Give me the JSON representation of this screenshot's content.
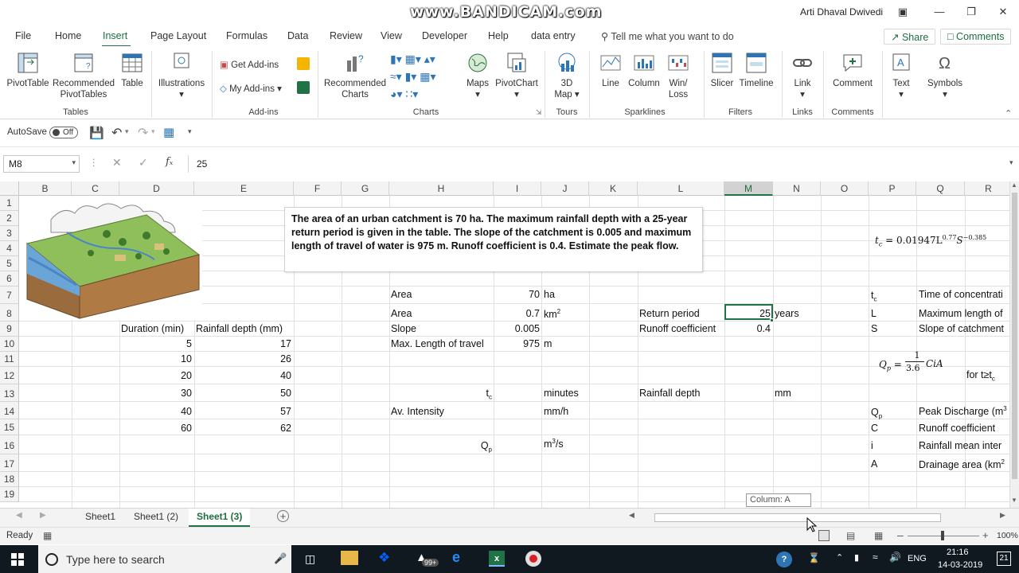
{
  "watermark": "www.BANDICAM.com",
  "user": "Arti Dhaval Dwivedi",
  "ribbon_tabs": [
    "File",
    "Home",
    "Insert",
    "Page Layout",
    "Formulas",
    "Data",
    "Review",
    "View",
    "Developer",
    "Help",
    "data entry"
  ],
  "tell_me": "Tell me what you want to do",
  "share": "Share",
  "comments": "Comments",
  "ribbon": {
    "tables": {
      "pivottable": "PivotTable",
      "recommended_pivot_1": "Recommended",
      "recommended_pivot_2": "PivotTables",
      "table": "Table",
      "group": "Tables"
    },
    "illustrations": "Illustrations",
    "addins": {
      "get": "Get Add-ins",
      "my": "My Add-ins",
      "group": "Add-ins"
    },
    "charts": {
      "rec1": "Recommended",
      "rec2": "Charts",
      "maps": "Maps",
      "pivotchart": "PivotChart",
      "group": "Charts"
    },
    "tours": {
      "map1": "3D",
      "map2": "Map",
      "group": "Tours"
    },
    "sparklines": {
      "line": "Line",
      "column": "Column",
      "winloss1": "Win/",
      "winloss2": "Loss",
      "group": "Sparklines"
    },
    "filters": {
      "slicer": "Slicer",
      "timeline": "Timeline",
      "group": "Filters"
    },
    "links": {
      "link": "Link",
      "group": "Links"
    },
    "comments": {
      "comment": "Comment",
      "group": "Comments"
    },
    "text": "Text",
    "symbols": "Symbols"
  },
  "autosave": {
    "label": "AutoSave",
    "state": "Off"
  },
  "namebox": "M8",
  "formula": "25",
  "columns": [
    "B",
    "C",
    "D",
    "E",
    "F",
    "G",
    "H",
    "I",
    "J",
    "K",
    "L",
    "M",
    "N",
    "O",
    "P",
    "Q",
    "R"
  ],
  "rows": [
    "1",
    "2",
    "3",
    "4",
    "5",
    "6",
    "7",
    "8",
    "9",
    "10",
    "11",
    "12",
    "13",
    "14",
    "15",
    "16",
    "17",
    "18",
    "19"
  ],
  "problem": "The area of an urban catchment is 70 ha. The maximum rainfall depth with a 25-year return period is given in the table. The slope of the catchment is 0.005 and maximum length of travel of water is 975 m. Runoff coefficient is 0.4.  Estimate the peak flow.",
  "table": {
    "h_duration": "Duration (min)",
    "h_rainfall": "Rainfall depth (mm)",
    "rows": [
      {
        "d": "5",
        "r": "17"
      },
      {
        "d": "10",
        "r": "26"
      },
      {
        "d": "20",
        "r": "40"
      },
      {
        "d": "30",
        "r": "50"
      },
      {
        "d": "40",
        "r": "57"
      },
      {
        "d": "60",
        "r": "62"
      }
    ]
  },
  "calc": {
    "area_label": "Area",
    "area_ha": "70",
    "unit_ha": "ha",
    "area2_label": "Area",
    "area_km2": "0.7",
    "unit_km": "km",
    "sup2": "2",
    "slope_label": "Slope",
    "slope": "0.005",
    "maxlen_label": "Max. Length of travel",
    "maxlen": "975",
    "unit_m": "m",
    "tc": "t",
    "tc_sub": "c",
    "minutes": "minutes",
    "avint": "Av. Intensity",
    "mmh": "mm/h",
    "qp": "Q",
    "qp_sub": "p",
    "m3s_a": "m",
    "m3s_sup": "3",
    "m3s_b": "/s",
    "return_label": "Return period",
    "return_val": "25",
    "years": "years",
    "runoff_label": "Runoff coefficient",
    "runoff_val": "0.4",
    "rainfall_depth": "Rainfall depth",
    "mm": "mm"
  },
  "legend": {
    "tc_formula_a": "t",
    "tc_formula_sub": "c",
    "tc_formula_b": " = 0.01947L",
    "tc_exp1": "0.77",
    "tc_formula_c": "S",
    "tc_exp2": "−0.385",
    "items": [
      {
        "sym": "t",
        "sub": "c",
        "desc": "Time of concentrati"
      },
      {
        "sym": "L",
        "sub": "",
        "desc": "Maximum length of"
      },
      {
        "sym": "S",
        "sub": "",
        "desc": "Slope of catchment"
      }
    ],
    "qp_a": "Q",
    "qp_sub": "p",
    "qp_eq": " = ",
    "qp_num": "1",
    "qp_den": "3.6",
    "qp_tail": "CiA",
    "for_t": "for t≥t",
    "for_sub": "c",
    "items2": [
      {
        "sym": "Q",
        "sub": "p",
        "desc": "Peak Discharge (m",
        "sup": "3"
      },
      {
        "sym": "C",
        "sub": "",
        "desc": "Runoff coefficient",
        "sup": ""
      },
      {
        "sym": "i",
        "sub": "",
        "desc": "Rainfall mean inter",
        "sup": ""
      },
      {
        "sym": "A",
        "sub": "",
        "desc": "Drainage area (km",
        "sup": "2"
      }
    ]
  },
  "tooltip": "Column: A",
  "sheets": [
    "Sheet1",
    "Sheet1 (2)",
    "Sheet1 (3)"
  ],
  "status": "Ready",
  "zoom": "100%",
  "taskbar": {
    "search": "Type here to search",
    "time": "21:16",
    "date": "14-03-2019",
    "lang": "ENG",
    "badge": "99+",
    "notif": "21"
  }
}
